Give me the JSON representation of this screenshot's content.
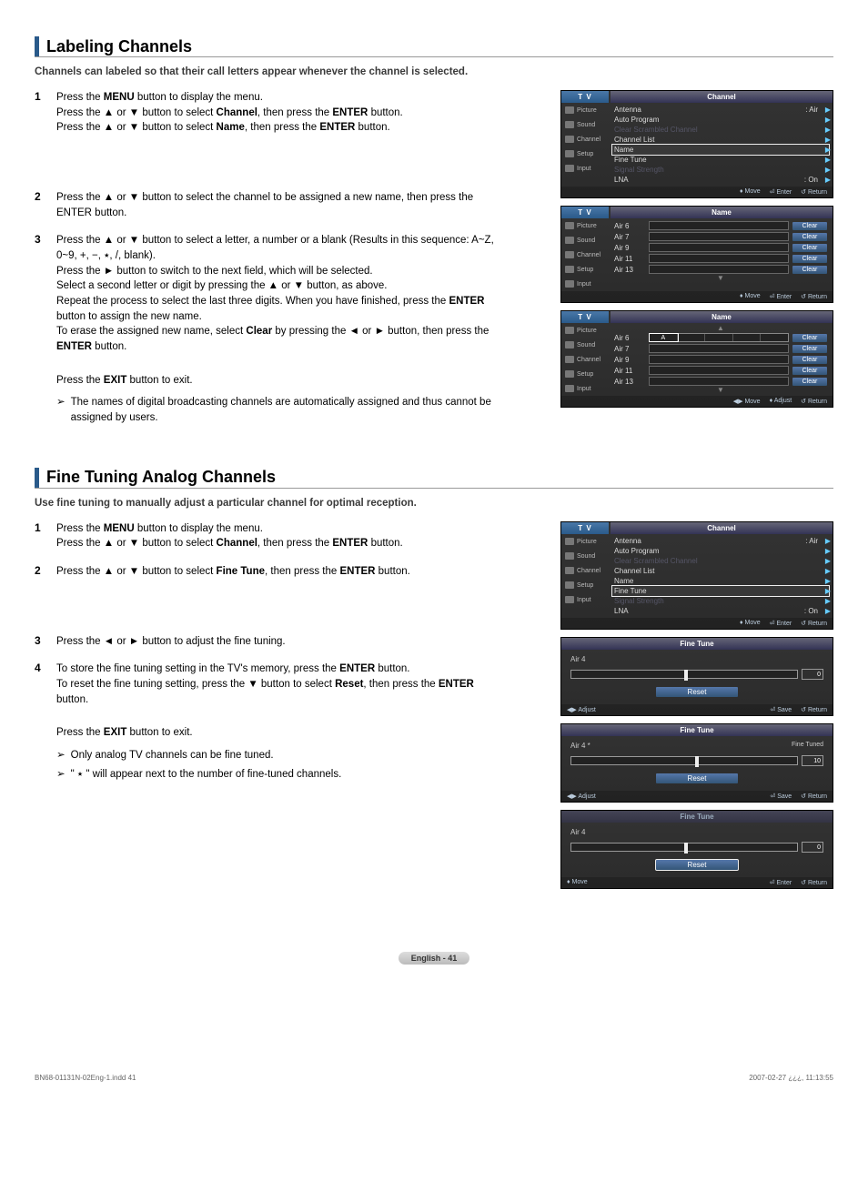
{
  "section1": {
    "title": "Labeling Channels",
    "intro": "Channels can labeled so that their call letters appear whenever the channel is selected.",
    "steps": {
      "s1a": "Press the MENU button to display the menu.",
      "s1b": "Press the ▲ or ▼ button to select Channel, then press the ENTER button.",
      "s1c": "Press the ▲ or ▼ button to select Name, then press the ENTER button.",
      "s2": "Press the ▲ or ▼ button to select the channel to be assigned a new name, then press the ENTER button.",
      "s3a": "Press the ▲ or ▼ button to select a letter, a number or a blank (Results in this sequence: A~Z, 0~9, +, −, ٭, /, blank).",
      "s3b": "Press the ► button to switch to the next field, which will be selected.",
      "s3c": "Select a second letter or digit by pressing the ▲ or ▼ button, as above.",
      "s3d": "Repeat the process to select the last three digits. When you have finished, press the ENTER button to assign the new name.",
      "s3e": "To erase the assigned new name, select Clear by pressing the ◄ or ► button, then press the ENTER button."
    },
    "exit": "Press the EXIT button to exit.",
    "note": "The names of digital broadcasting channels are automatically assigned and thus cannot be assigned by users."
  },
  "section2": {
    "title": "Fine Tuning Analog Channels",
    "intro": "Use fine tuning to manually adjust a particular channel for optimal reception.",
    "steps": {
      "s1a": "Press the MENU button to display the menu.",
      "s1b": "Press the ▲ or ▼ button to select Channel, then press the ENTER button.",
      "s2": "Press the ▲ or ▼ button to select Fine Tune, then press the ENTER button.",
      "s3": "Press the ◄ or ► button to adjust the fine tuning.",
      "s4a": "To store the fine tuning setting in the TV's memory, press the ENTER button.",
      "s4b": "To reset the fine tuning setting, press the ▼ button to select Reset, then press the ENTER button."
    },
    "exit": "Press the EXIT button to exit.",
    "note1": "Only analog TV channels can be fine tuned.",
    "note2": "\" ٭ \" will appear next to the number of fine-tuned channels."
  },
  "osd": {
    "tv": "T V",
    "tab_channel": "Channel",
    "tab_name": "Name",
    "tab_finetune": "Fine Tune",
    "side": [
      "Picture",
      "Sound",
      "Channel",
      "Setup",
      "Input"
    ],
    "ch_menu": {
      "antenna": "Antenna",
      "antenna_val": ": Air",
      "auto": "Auto Program",
      "csc": "Clear Scrambled Channel",
      "list": "Channel List",
      "name": "Name",
      "fine": "Fine Tune",
      "ss": "Signal Strength",
      "lna": "LNA",
      "lna_val": ": On"
    },
    "name_list": [
      "Air 6",
      "Air 7",
      "Air 9",
      "Air 11",
      "Air 13"
    ],
    "clear": "Clear",
    "letter": "A",
    "ftr_move": "Move",
    "ftr_enter": "Enter",
    "ftr_return": "Return",
    "ftr_adjust": "Adjust",
    "ftr_save": "Save",
    "ft": {
      "ch": "Air  4",
      "ch_star": "Air  4 *",
      "tuned": "Fine Tuned",
      "reset": "Reset",
      "v0": "0",
      "v10": "10"
    }
  },
  "footer": {
    "label": "English - 41"
  },
  "print": {
    "left": "BN68-01131N-02Eng-1.indd   41",
    "right": "2007-02-27   ¿¿¿, 11:13:55"
  }
}
